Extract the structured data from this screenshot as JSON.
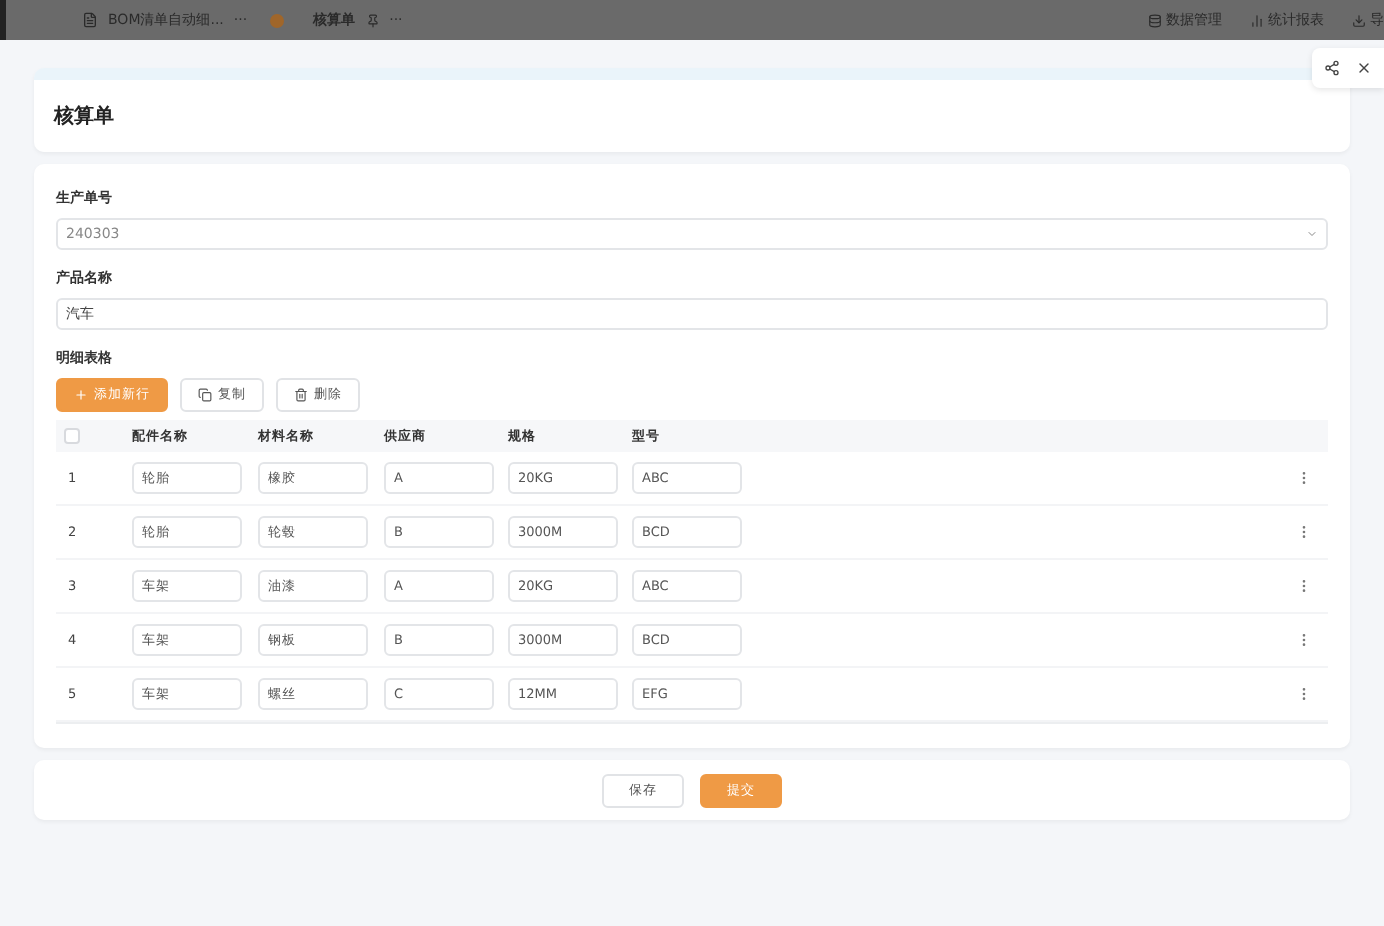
{
  "topbar": {
    "app_title": "BOM清单自动细...",
    "more": "···",
    "page_title": "核算单",
    "page_more": "···",
    "links": [
      "数据管理",
      "统计报表",
      "导"
    ]
  },
  "form_title": "核算单",
  "fields": [
    {
      "kind": "select",
      "label": "生产单号",
      "value": "240303"
    },
    {
      "kind": "text",
      "label": "产品名称",
      "value": "汽车"
    }
  ],
  "detail": {
    "label": "明细表格",
    "actions": [
      {
        "kind": "add",
        "label": "添加新行"
      },
      {
        "kind": "copy",
        "label": "复制"
      },
      {
        "kind": "delete",
        "label": "删除"
      }
    ],
    "all_checked": false,
    "columns": [
      "配件名称",
      "材料名称",
      "供应商",
      "规格",
      "型号"
    ],
    "rows": [
      {
        "index": "1",
        "cells": [
          "轮胎",
          "橡胶",
          "A",
          "20KG",
          "ABC"
        ]
      },
      {
        "index": "2",
        "cells": [
          "轮胎",
          "轮毂",
          "B",
          "3000M",
          "BCD"
        ]
      },
      {
        "index": "3",
        "cells": [
          "车架",
          "油漆",
          "A",
          "20KG",
          "ABC"
        ]
      },
      {
        "index": "4",
        "cells": [
          "车架",
          "钢板",
          "B",
          "3000M",
          "BCD"
        ]
      },
      {
        "index": "5",
        "cells": [
          "车架",
          "螺丝",
          "C",
          "12MM",
          "EFG"
        ]
      }
    ]
  },
  "buttons": [
    {
      "kind": "secondary",
      "label": "保存"
    },
    {
      "kind": "primary",
      "label": "提交"
    }
  ]
}
